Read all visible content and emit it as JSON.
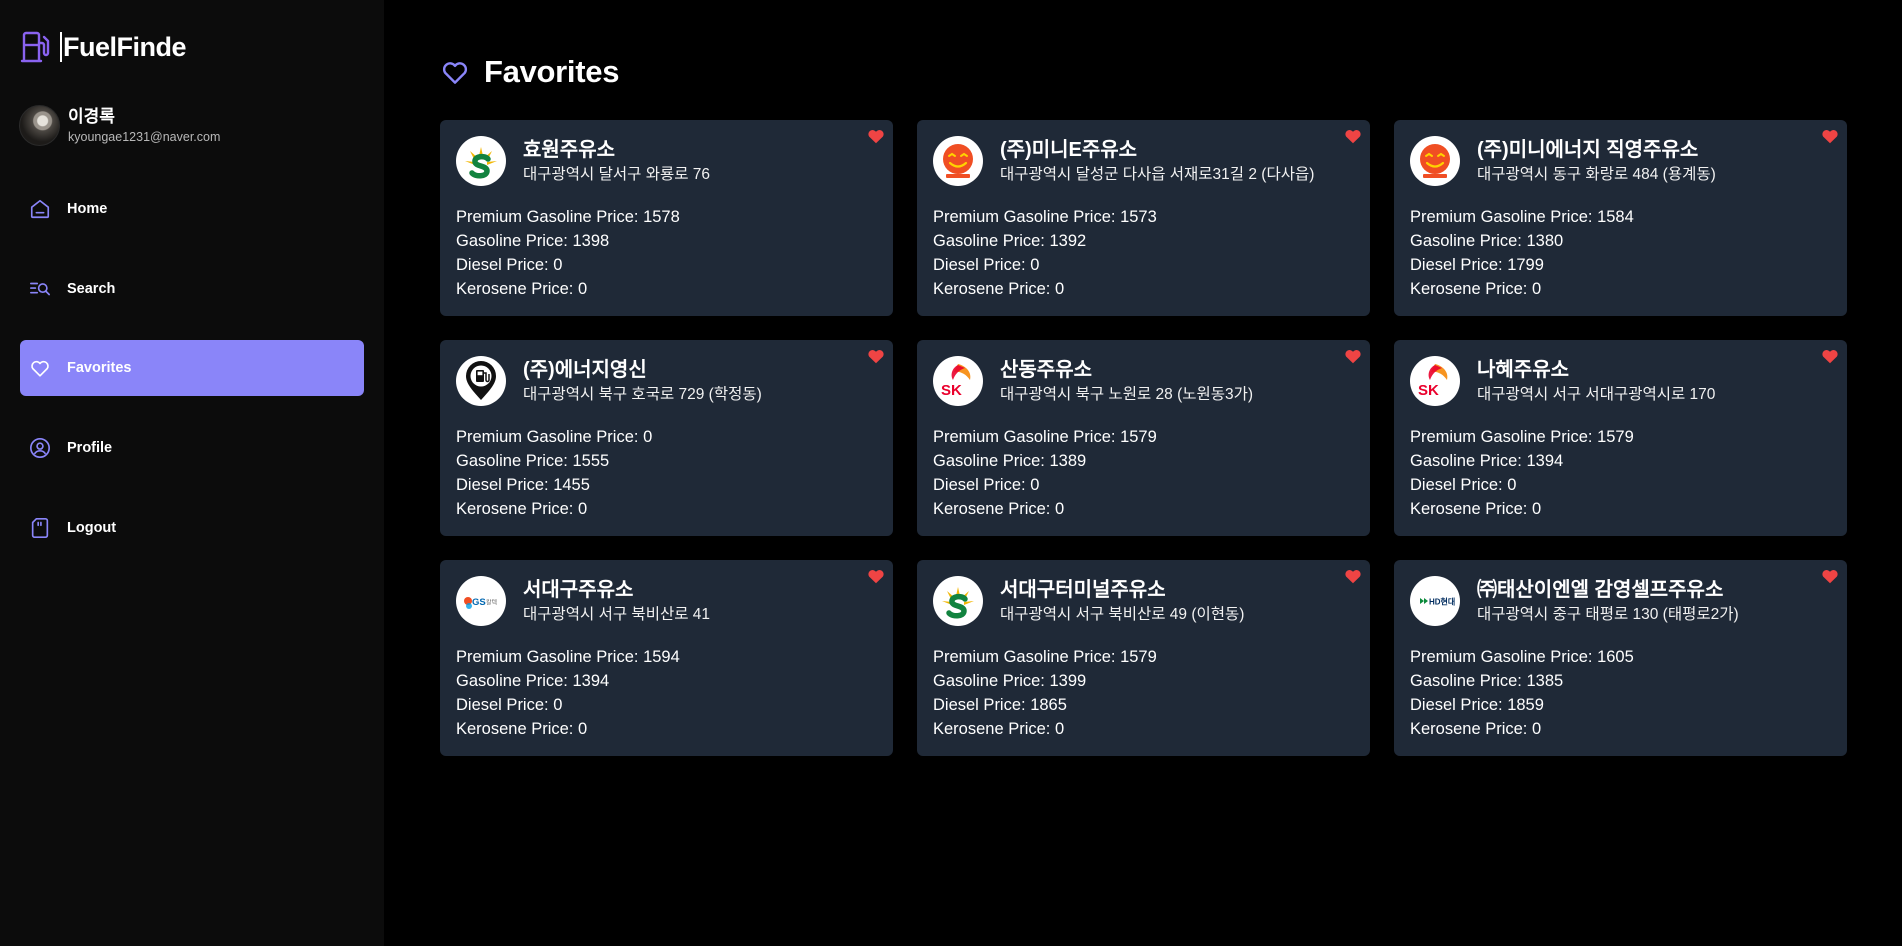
{
  "app": {
    "title": "FuelFinde"
  },
  "user": {
    "name": "이경록",
    "email": "kyoungae1231@naver.com"
  },
  "nav": [
    {
      "label": "Home",
      "icon": "home-icon"
    },
    {
      "label": "Search",
      "icon": "search-list-icon"
    },
    {
      "label": "Favorites",
      "icon": "heart-icon"
    },
    {
      "label": "Profile",
      "icon": "user-circle-icon"
    },
    {
      "label": "Logout",
      "icon": "sd-card-icon"
    }
  ],
  "page": {
    "title": "Favorites"
  },
  "labels": {
    "premium": "Premium Gasoline Price: ",
    "gasoline": "Gasoline Price: ",
    "diesel": "Diesel Price: ",
    "kerosene": "Kerosene Price: "
  },
  "colors": {
    "accent": "#8a85f9",
    "heart": "#ef4444",
    "card": "#1f2937",
    "sidebar": "#0c0c0c"
  },
  "stations": [
    {
      "name": "효원주유소",
      "address": "대구광역시 달서구 와룡로 76",
      "brand": "s-oil-logo",
      "premium": "1578",
      "gasoline": "1398",
      "diesel": "0",
      "kerosene": "0"
    },
    {
      "name": "(주)미니E주유소",
      "address": "대구광역시 달성군 다사읍 서재로31길 2 (다사읍)",
      "brand": "alddle-logo",
      "premium": "1573",
      "gasoline": "1392",
      "diesel": "0",
      "kerosene": "0"
    },
    {
      "name": "(주)미니에너지 직영주유소",
      "address": "대구광역시 동구 화랑로 484 (용계동)",
      "brand": "alddle-logo",
      "premium": "1584",
      "gasoline": "1380",
      "diesel": "1799",
      "kerosene": "0"
    },
    {
      "name": "(주)에너지영신",
      "address": "대구광역시 북구 호국로 729 (학정동)",
      "brand": "fuel-pin-logo",
      "premium": "0",
      "gasoline": "1555",
      "diesel": "1455",
      "kerosene": "0"
    },
    {
      "name": "산동주유소",
      "address": "대구광역시 북구 노원로 28 (노원동3가)",
      "brand": "sk-logo",
      "premium": "1579",
      "gasoline": "1389",
      "diesel": "0",
      "kerosene": "0"
    },
    {
      "name": "나혜주유소",
      "address": "대구광역시 서구 서대구광역시로 170",
      "brand": "sk-logo",
      "premium": "1579",
      "gasoline": "1394",
      "diesel": "0",
      "kerosene": "0"
    },
    {
      "name": "서대구주유소",
      "address": "대구광역시 서구 북비산로 41",
      "brand": "gs-logo",
      "premium": "1594",
      "gasoline": "1394",
      "diesel": "0",
      "kerosene": "0"
    },
    {
      "name": "서대구터미널주유소",
      "address": "대구광역시 서구 북비산로 49 (이현동)",
      "brand": "s-oil-logo",
      "premium": "1579",
      "gasoline": "1399",
      "diesel": "1865",
      "kerosene": "0"
    },
    {
      "name": "㈜태산이엔엘 감영셀프주유소",
      "address": "대구광역시 중구 태평로 130 (태평로2가)",
      "brand": "hd-logo",
      "premium": "1605",
      "gasoline": "1385",
      "diesel": "1859",
      "kerosene": "0"
    }
  ]
}
